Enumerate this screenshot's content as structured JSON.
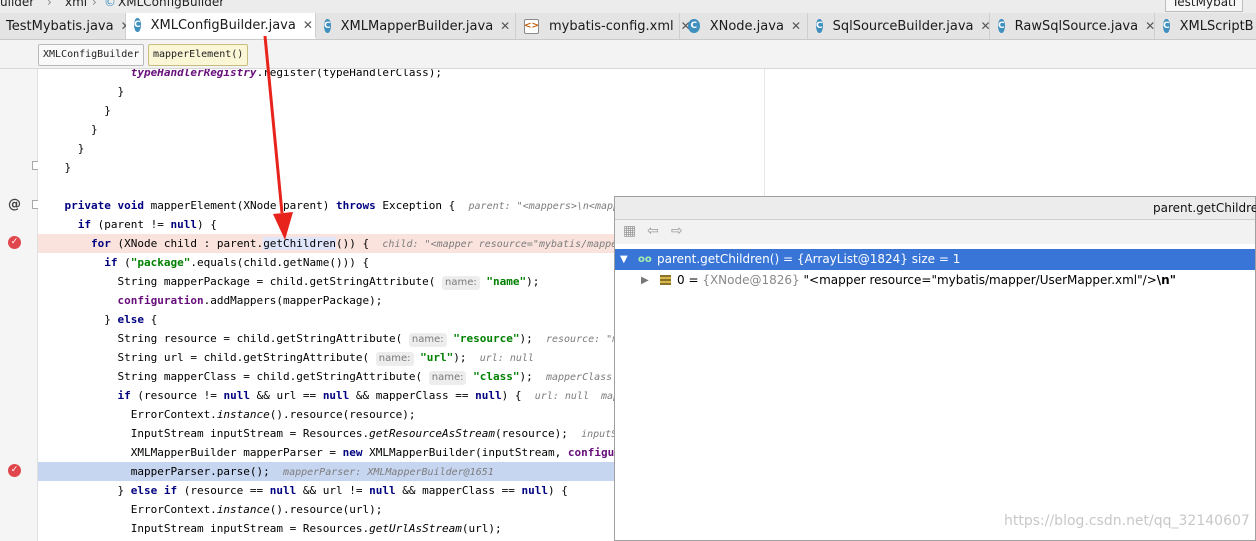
{
  "top": {
    "breadcrumbs": [
      "uilder",
      "xml",
      "XMLConfigBuilder"
    ],
    "run_config": "TestMybati"
  },
  "tabs": [
    {
      "label": "TestMybatis.java",
      "icon": "java-class-icon",
      "active": false
    },
    {
      "label": "XMLConfigBuilder.java",
      "icon": "java-class-icon",
      "active": true
    },
    {
      "label": "XMLMapperBuilder.java",
      "icon": "java-class-icon",
      "active": false
    },
    {
      "label": "mybatis-config.xml",
      "icon": "xml-file-icon",
      "active": false
    },
    {
      "label": "XNode.java",
      "icon": "java-class-icon",
      "active": false
    },
    {
      "label": "SqlSourceBuilder.java",
      "icon": "java-class-icon",
      "active": false
    },
    {
      "label": "RawSqlSource.java",
      "icon": "java-class-icon",
      "active": false
    },
    {
      "label": "XMLScriptB",
      "icon": "java-class-icon",
      "active": false
    }
  ],
  "breadcrumb_bar": {
    "class_name": "XMLConfigBuilder",
    "method_name": "mapperElement()"
  },
  "code": {
    "l1": "typeHandlerRegistry",
    "l1b": ".register(typeHandlerClass);",
    "sig": "mapperElement(XNode parent) ",
    "sig_hint": "parent: \"<mappers>\\n<mapper r",
    "for_hint": "child: \"<mapper resource=\"mybatis/mapper/User",
    "s_package": "\"package\"",
    "s_name": "\"name\"",
    "s_resource": "\"resource\"",
    "s_url": "\"url\"",
    "s_class": "\"class\"",
    "name_hint": "name:",
    "resource_hint": "resource: \"mybatis/",
    "url_hint": "url: null",
    "mapperclass_hint": "mapperClass: null",
    "if_hint": "url: null  mapperCla",
    "is_hint": "inputStream: Bu",
    "parse_hint": "mapperParser: XMLMapperBuilder@1651"
  },
  "popup": {
    "title": "parent.getChildren",
    "root_row": "parent.getChildren() = {ArrayList@1824}  size = 1",
    "child_index": "0 = ",
    "child_type": "{XNode@1826}",
    "child_value": " \"<mapper resource=\"mybatis/mapper/UserMapper.xml\"/>",
    "child_value_tail": "\\n\""
  },
  "watermark": "https://blog.csdn.net/qq_32140607",
  "colors": {
    "selection": "#3875d7",
    "breakpoint": "#e0474c",
    "keyword": "#000080",
    "string": "#008000",
    "arrow": "#e8231c"
  }
}
